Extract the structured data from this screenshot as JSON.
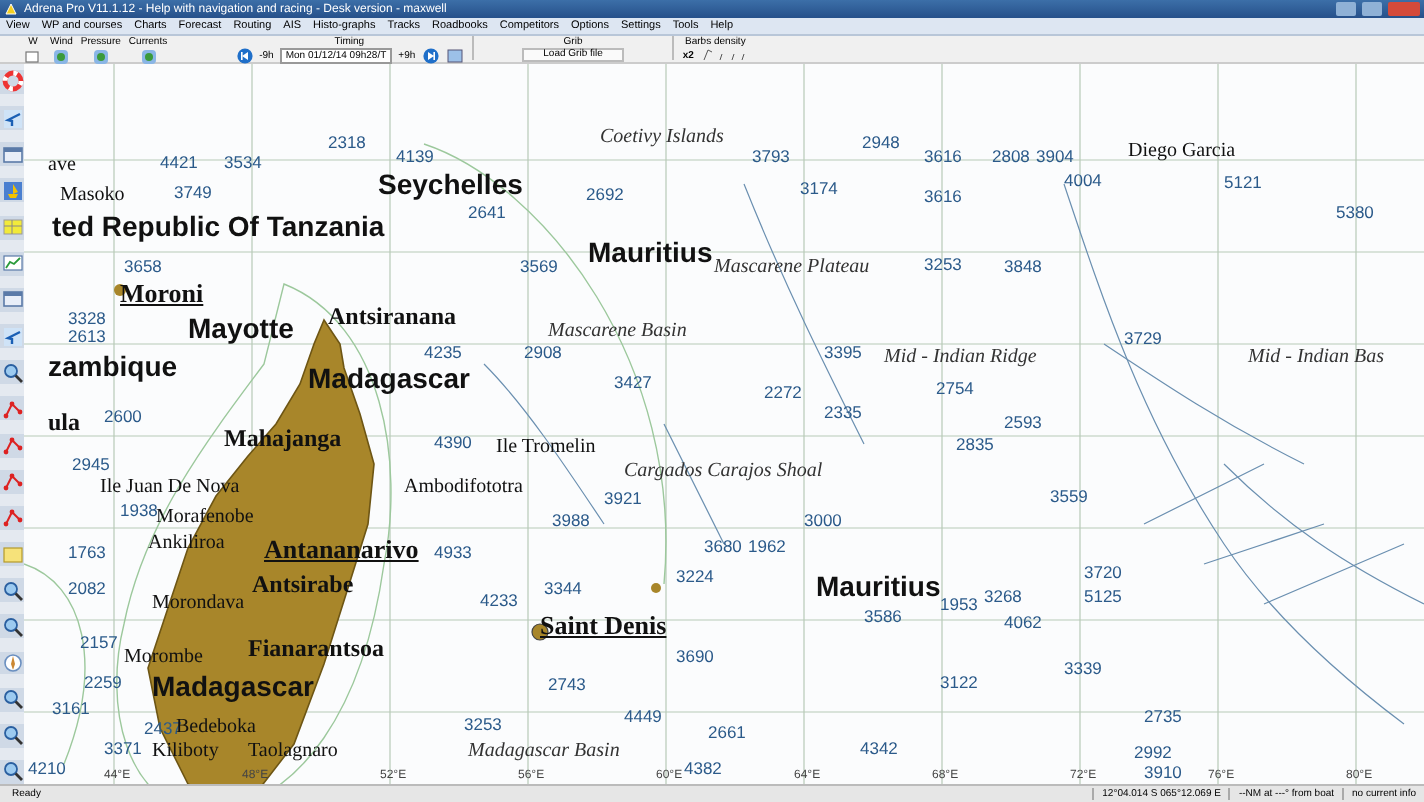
{
  "window": {
    "title": "Adrena Pro V11.1.12 - Help with navigation and racing - Desk version - maxwell"
  },
  "menu": [
    "View",
    "WP and courses",
    "Charts",
    "Forecast",
    "Routing",
    "AIS",
    "Histo-graphs",
    "Tracks",
    "Roadbooks",
    "Competitors",
    "Options",
    "Settings",
    "Tools",
    "Help"
  ],
  "ribbon": {
    "groups": [
      {
        "label": "W"
      },
      {
        "label": "Wind"
      },
      {
        "label": "Pressure"
      },
      {
        "label": "Currents"
      }
    ],
    "timing": {
      "label": "Timing",
      "back": "-9h",
      "date": "Mon 01/12/14 09h28/T",
      "forward": "+9h"
    },
    "grib": {
      "label": "Grib",
      "button": "Load Grib file"
    },
    "barbs": {
      "label": "Barbs density",
      "value": "x2"
    }
  },
  "left_toolbar": [
    {
      "kind": "lifebuoy"
    },
    {
      "kind": "arrow"
    },
    {
      "kind": "window"
    },
    {
      "kind": "boat"
    },
    {
      "kind": "table"
    },
    {
      "kind": "graph"
    },
    {
      "kind": "window"
    },
    {
      "kind": "arrow"
    },
    {
      "kind": "zoom"
    },
    {
      "kind": "route"
    },
    {
      "kind": "route"
    },
    {
      "kind": "route"
    },
    {
      "kind": "route"
    },
    {
      "kind": "note"
    },
    {
      "kind": "zoom"
    },
    {
      "kind": "zoom"
    },
    {
      "kind": "compass"
    },
    {
      "kind": "zoom"
    },
    {
      "kind": "zoom"
    },
    {
      "kind": "zoom"
    }
  ],
  "chart": {
    "places": [
      {
        "text": "Coetivy Islands",
        "kind": "feature"
      },
      {
        "text": "Diego Garcia",
        "kind": "town"
      },
      {
        "text": "Seychelles",
        "kind": "country"
      },
      {
        "text": "ave",
        "kind": "town"
      },
      {
        "text": "Masoko",
        "kind": "town"
      },
      {
        "text": "ted Republic Of Tanzania",
        "kind": "country"
      },
      {
        "text": "Mauritius",
        "kind": "country"
      },
      {
        "text": "Mascarene Plateau",
        "kind": "feature"
      },
      {
        "text": "Moroni",
        "kind": "capital"
      },
      {
        "text": "Antsiranana",
        "kind": "city"
      },
      {
        "text": "Mayotte",
        "kind": "country"
      },
      {
        "text": "Mascarene Basin",
        "kind": "feature"
      },
      {
        "text": "Mid - Indian Ridge",
        "kind": "feature"
      },
      {
        "text": "Mid - Indian Bas",
        "kind": "feature"
      },
      {
        "text": "zambique",
        "kind": "country"
      },
      {
        "text": "Madagascar",
        "kind": "country"
      },
      {
        "text": "ula",
        "kind": "city"
      },
      {
        "text": "Mahajanga",
        "kind": "city"
      },
      {
        "text": "Ile Tromelin",
        "kind": "town"
      },
      {
        "text": "Cargados Carajos Shoal",
        "kind": "feature"
      },
      {
        "text": "Ile Juan De Nova",
        "kind": "town"
      },
      {
        "text": "Ambodifototra",
        "kind": "town"
      },
      {
        "text": "Morafenobe",
        "kind": "town"
      },
      {
        "text": "Ankiliroa",
        "kind": "town"
      },
      {
        "text": "Antananarivo",
        "kind": "capital"
      },
      {
        "text": "Antsirabe",
        "kind": "city"
      },
      {
        "text": "Morondava",
        "kind": "town"
      },
      {
        "text": "Mauritius",
        "kind": "country"
      },
      {
        "text": "Saint Denis",
        "kind": "capital"
      },
      {
        "text": "Fianarantsoa",
        "kind": "city"
      },
      {
        "text": "Morombe",
        "kind": "town"
      },
      {
        "text": "Madagascar",
        "kind": "country"
      },
      {
        "text": "Bedeboka",
        "kind": "town"
      },
      {
        "text": "Kiliboty",
        "kind": "town"
      },
      {
        "text": "Taolagnaro",
        "kind": "town"
      },
      {
        "text": "Madagascar Basin",
        "kind": "feature"
      }
    ],
    "soundings": [
      "4421",
      "3534",
      "2318",
      "4139",
      "3793",
      "2948",
      "3616",
      "2808",
      "3904",
      "5121",
      "3749",
      "2641",
      "3658",
      "2692",
      "3174",
      "3616",
      "4004",
      "5380",
      "3328",
      "2613",
      "2600",
      "3569",
      "3253",
      "3848",
      "4235",
      "2908",
      "2945",
      "3395",
      "3427",
      "2335",
      "2754",
      "3729",
      "1938",
      "4390",
      "3921",
      "2272",
      "2593",
      "1763",
      "2082",
      "4933",
      "3988",
      "3680",
      "1962",
      "3000",
      "2835",
      "3559",
      "2157",
      "3224",
      "2259",
      "4233",
      "3268",
      "4062",
      "5125",
      "3720",
      "3161",
      "3344",
      "3690",
      "2735",
      "1953",
      "2437",
      "2743",
      "4449",
      "3122",
      "3339",
      "3371",
      "3253",
      "2661",
      "3586",
      "2992",
      "4210",
      "4382",
      "4342",
      "3910"
    ],
    "longitudes": [
      "44°E",
      "48°E",
      "52°E",
      "56°E",
      "60°E",
      "64°E",
      "68°E",
      "72°E",
      "76°E",
      "80°E"
    ]
  },
  "status_bar": [
    "Ready",
    "12°04.014 S 065°12.069 E",
    "--NM at ---° from boat",
    "no current info"
  ]
}
